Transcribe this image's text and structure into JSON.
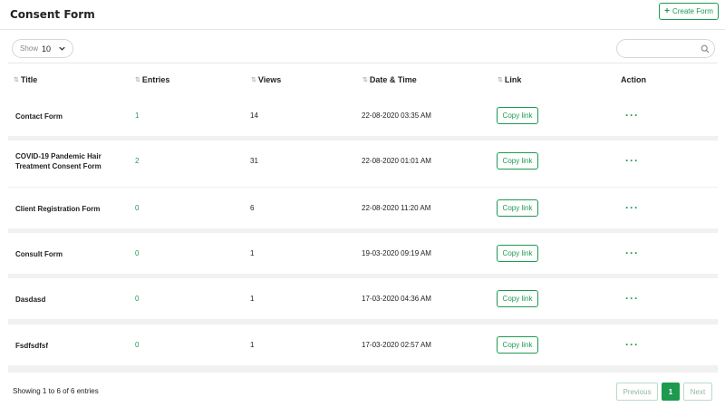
{
  "header": {
    "title": "Consent Form",
    "create_label": "Create Form"
  },
  "controls": {
    "show_label": "Show",
    "show_value": "10",
    "search_placeholder": ""
  },
  "table": {
    "columns": [
      "Title",
      "Entries",
      "Views",
      "Date & Time",
      "Link",
      "Action"
    ],
    "rows": [
      {
        "title": "Contact Form",
        "entries": "1",
        "views": "14",
        "datetime": "22-08-2020 03:35 AM",
        "link": "Copy link"
      },
      {
        "title": "COVID-19 Pandemic Hair Treatment Consent Form",
        "entries": "2",
        "views": "31",
        "datetime": "22-08-2020 01:01 AM",
        "link": "Copy link"
      },
      {
        "title": "Client Registration Form",
        "entries": "0",
        "views": "6",
        "datetime": "22-08-2020 11:20 AM",
        "link": "Copy link"
      },
      {
        "title": "Consult Form",
        "entries": "0",
        "views": "1",
        "datetime": "19-03-2020 09:19 AM",
        "link": "Copy link"
      },
      {
        "title": "Dasdasd",
        "entries": "0",
        "views": "1",
        "datetime": "17-03-2020 04:36 AM",
        "link": "Copy link"
      },
      {
        "title": "Fsdfsdfsf",
        "entries": "0",
        "views": "1",
        "datetime": "17-03-2020 02:57 AM",
        "link": "Copy link"
      }
    ],
    "action_symbol": "···"
  },
  "footer": {
    "info": "Showing 1 to 6 of 6 entries",
    "previous": "Previous",
    "current_page": "1",
    "next": "Next"
  },
  "colors": {
    "accent": "#1e9a4f"
  }
}
